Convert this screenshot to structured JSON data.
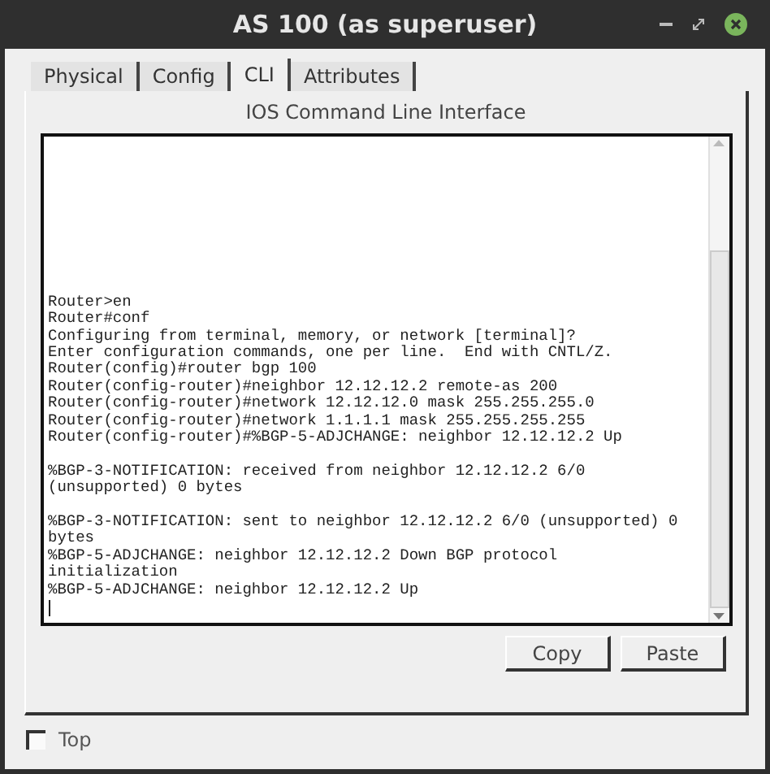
{
  "window": {
    "title": "AS 100 (as superuser)"
  },
  "tabs": [
    {
      "label": "Physical",
      "selected": false
    },
    {
      "label": "Config",
      "selected": false
    },
    {
      "label": "CLI",
      "selected": true
    },
    {
      "label": "Attributes",
      "selected": false
    }
  ],
  "panel_title": "IOS Command Line Interface",
  "terminal": {
    "blocks": [
      [
        "Router>en",
        "Router#conf",
        "Configuring from terminal, memory, or network [terminal]?",
        "Enter configuration commands, one per line.  End with CNTL/Z.",
        "Router(config)#router bgp 100",
        "Router(config-router)#neighbor 12.12.12.2 remote-as 200",
        "Router(config-router)#network 12.12.12.0 mask 255.255.255.0",
        "Router(config-router)#network 1.1.1.1 mask 255.255.255.255",
        "Router(config-router)#%BGP-5-ADJCHANGE: neighbor 12.12.12.2 Up"
      ],
      [
        "%BGP-3-NOTIFICATION: received from neighbor 12.12.12.2 6/0",
        "(unsupported) 0 bytes"
      ],
      [
        "%BGP-3-NOTIFICATION: sent to neighbor 12.12.12.2 6/0 (unsupported) 0",
        "bytes",
        "%BGP-5-ADJCHANGE: neighbor 12.12.12.2 Down BGP protocol",
        "initialization",
        "%BGP-5-ADJCHANGE: neighbor 12.12.12.2 Up"
      ]
    ]
  },
  "buttons": [
    "Copy",
    "Paste"
  ],
  "top_checkbox": {
    "label": "Top",
    "checked": false
  }
}
